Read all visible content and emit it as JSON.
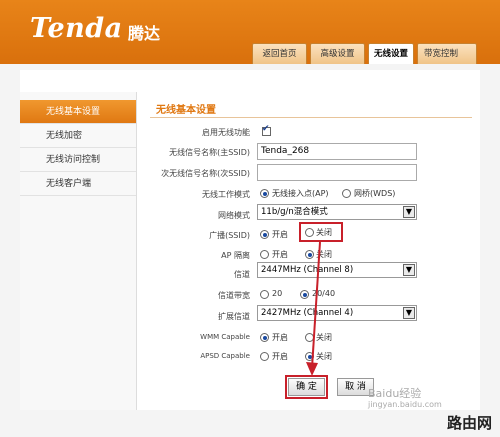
{
  "brand": {
    "logo": "Tenda",
    "logo_cn": "腾达",
    "accent": "#e07812",
    "highlight": "#c8202a"
  },
  "tabs": [
    {
      "label": "返回首页"
    },
    {
      "label": "高级设置"
    },
    {
      "label": "无线设置"
    },
    {
      "label": "带宽控制"
    }
  ],
  "sidebar": {
    "items": [
      {
        "label": "无线基本设置"
      },
      {
        "label": "无线加密"
      },
      {
        "label": "无线访问控制"
      },
      {
        "label": "无线客户端"
      }
    ]
  },
  "panel": {
    "title": "无线基本设置",
    "enable_wireless": {
      "label": "启用无线功能",
      "checked": true
    },
    "ssid_main": {
      "label": "无线信号名称(主SSID)",
      "value": "Tenda_268"
    },
    "ssid_secondary": {
      "label": "次无线信号名称(次SSID)",
      "value": ""
    },
    "work_mode": {
      "label": "无线工作模式",
      "opt1": "无线接入点(AP)",
      "opt2": "网桥(WDS)"
    },
    "network_mode": {
      "label": "网络模式",
      "value": "11b/g/n混合模式"
    },
    "broadcast": {
      "label": "广播(SSID)",
      "on": "开启",
      "off": "关闭"
    },
    "ap_isolation": {
      "label": "AP 隔离",
      "on": "开启",
      "off": "关闭"
    },
    "channel": {
      "label": "信道",
      "value": "2447MHz (Channel 8)"
    },
    "bandwidth": {
      "label": "信道带宽",
      "opt1": "20",
      "opt2": "20/40"
    },
    "ext_channel": {
      "label": "扩展信道",
      "value": "2427MHz (Channel 4)"
    },
    "wmm": {
      "label": "WMM Capable",
      "on": "开启",
      "off": "关闭"
    },
    "apsd": {
      "label": "APSD Capable",
      "on": "开启",
      "off": "关闭"
    },
    "ok_label": "确 定",
    "cancel_label": "取 消"
  },
  "watermark": {
    "site": "Baidu经验",
    "url": "jingyan.baidu.com"
  },
  "corner_mark": "路由网"
}
